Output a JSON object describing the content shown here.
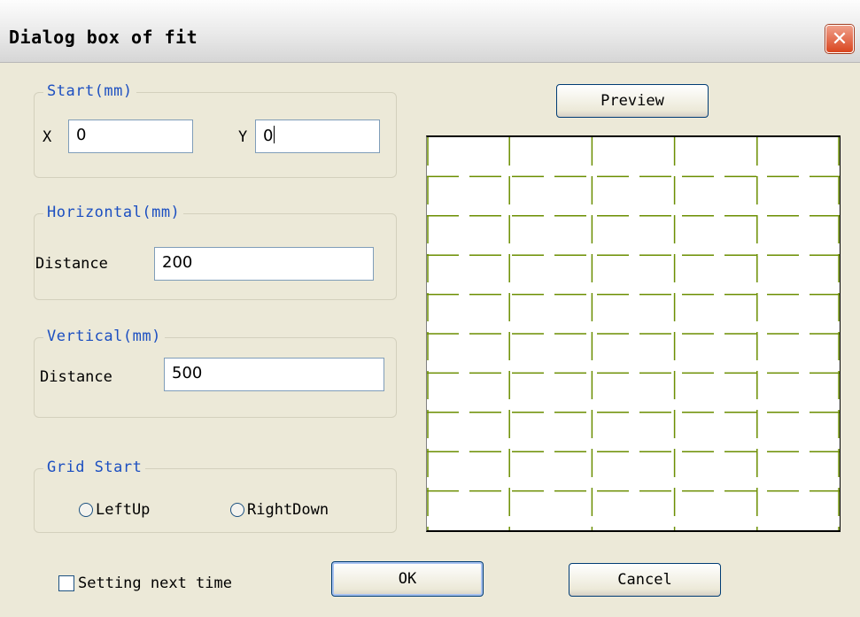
{
  "dialog": {
    "title": "Dialog box of fit",
    "close_glyph": "✕"
  },
  "start_group": {
    "label": "Start(mm)",
    "x_label": "X",
    "x_value": "0",
    "y_label": "Y",
    "y_value": "0"
  },
  "horizontal_group": {
    "label": "Horizontal(mm)",
    "distance_label": "Distance",
    "distance_value": "200"
  },
  "vertical_group": {
    "label": "Vertical(mm)",
    "distance_label": "Distance",
    "distance_value": "500"
  },
  "grid_start_group": {
    "label": "Grid Start",
    "options": [
      "LeftUp",
      "RightDown"
    ],
    "selected": null
  },
  "preview": {
    "button_label": "Preview",
    "grid_color": "#6b8e00",
    "columns": 5,
    "rows": 10
  },
  "footer": {
    "setting_next_time_label": "Setting next time",
    "setting_next_time_checked": false,
    "ok_label": "OK",
    "cancel_label": "Cancel"
  }
}
